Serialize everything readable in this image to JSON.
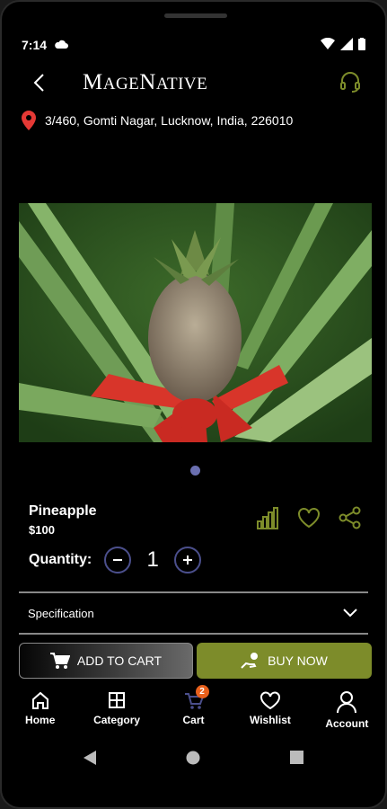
{
  "status": {
    "time": "7:14"
  },
  "header": {
    "brand_big_m": "M",
    "brand_rest1": "AGE",
    "brand_big_n": "N",
    "brand_rest2": "ATIVE"
  },
  "address": "3/460, Gomti Nagar, Lucknow, India, 226010",
  "product": {
    "name": "Pineapple",
    "price": "$100"
  },
  "quantity": {
    "label": "Quantity:",
    "value": "1"
  },
  "specification": {
    "label": "Specification"
  },
  "buttons": {
    "add_to_cart": "ADD TO CART",
    "buy_now": "BUY NOW"
  },
  "nav": {
    "home": "Home",
    "category": "Category",
    "cart": "Cart",
    "cart_badge": "2",
    "wishlist": "Wishlist",
    "account": "Account"
  },
  "colors": {
    "accent_olive": "#7d8c2a",
    "nav_active": "#4b4f8c",
    "badge": "#e8601c",
    "pin": "#e53935"
  }
}
